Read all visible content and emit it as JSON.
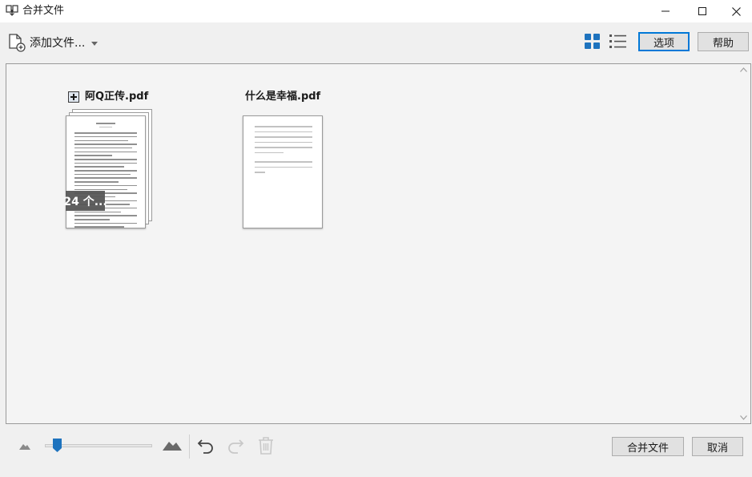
{
  "window": {
    "title": "合并文件",
    "icon": "merge-files-icon"
  },
  "toolbar": {
    "add_files_label": "添加文件...",
    "options_label": "选项",
    "help_label": "帮助"
  },
  "documents": [
    {
      "name": "阿Q正传.pdf",
      "pages_badge": "24 个...",
      "expandable": true
    },
    {
      "name": "什么是幸福.pdf",
      "expandable": false
    }
  ],
  "bottom": {
    "zoom_value_percent": 10,
    "merge_label": "合并文件",
    "cancel_label": "取消"
  },
  "colors": {
    "accent": "#0078d7",
    "icon_blue": "#1e73be",
    "disabled_gray": "#c8c8c8"
  }
}
